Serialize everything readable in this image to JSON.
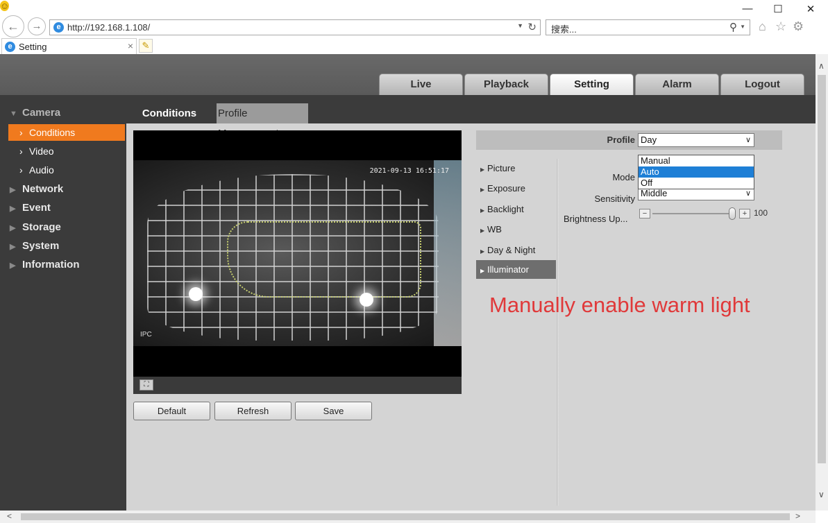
{
  "browser": {
    "url": "http://192.168.1.108/",
    "search_placeholder": "搜索...",
    "tab_title": "Setting",
    "back_icon": "back-arrow-icon",
    "forward_icon": "forward-arrow-icon"
  },
  "main_nav": {
    "tabs": [
      {
        "label": "Live"
      },
      {
        "label": "Playback"
      },
      {
        "label": "Setting",
        "active": true
      },
      {
        "label": "Alarm"
      },
      {
        "label": "Logout"
      }
    ]
  },
  "sidebar": {
    "camera": "Camera",
    "conditions": "Conditions",
    "video": "Video",
    "audio": "Audio",
    "network": "Network",
    "event": "Event",
    "storage": "Storage",
    "system": "System",
    "information": "Information"
  },
  "subtabs": {
    "conditions": "Conditions",
    "profile_management": "Profile Management"
  },
  "video_overlay": {
    "timestamp": "2021-09-13 16:51:17",
    "channel": "IPC"
  },
  "buttons": {
    "default": "Default",
    "refresh": "Refresh",
    "save": "Save"
  },
  "profile": {
    "label": "Profile",
    "value": "Day"
  },
  "settings_nav": {
    "picture": "Picture",
    "exposure": "Exposure",
    "backlight": "Backlight",
    "wb": "WB",
    "day_night": "Day & Night",
    "illuminator": "Illuminator"
  },
  "illuminator": {
    "mode_label": "Mode",
    "mode_options": [
      "Manual",
      "Auto",
      "Off"
    ],
    "mode_selected": "Auto",
    "sensitivity_label": "Sensitivity",
    "sensitivity_value": "Middle",
    "brightness_label": "Brightness Up...",
    "brightness_value": "100",
    "brightness_fraction": 1.0
  },
  "annotation": "Manually enable warm light",
  "colors": {
    "accent": "#f07a1e",
    "annotation": "#e0393a",
    "selection": "#1e7fd6"
  }
}
